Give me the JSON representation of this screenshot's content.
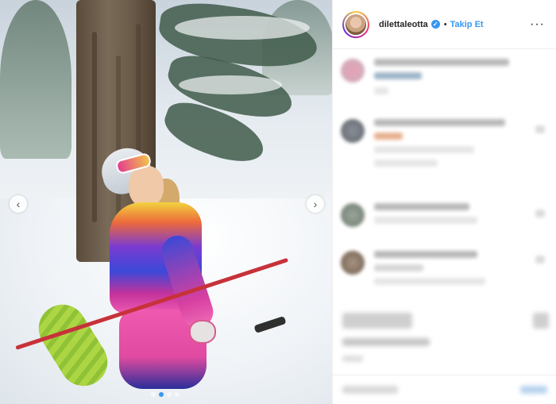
{
  "post": {
    "username": "dilettaleotta",
    "separator": "•",
    "follow_label": "Takip Et",
    "more_label": "···",
    "verified_mark": "✓"
  },
  "carousel": {
    "prev_label": "‹",
    "next_label": "›",
    "slides": 4,
    "active_slide": 2
  },
  "colors": {
    "accent": "#3897f0",
    "text": "#262626",
    "divider": "#efefef"
  },
  "icons": [
    "verified-badge-icon",
    "more-options-icon",
    "chevron-left-icon",
    "chevron-right-icon"
  ]
}
